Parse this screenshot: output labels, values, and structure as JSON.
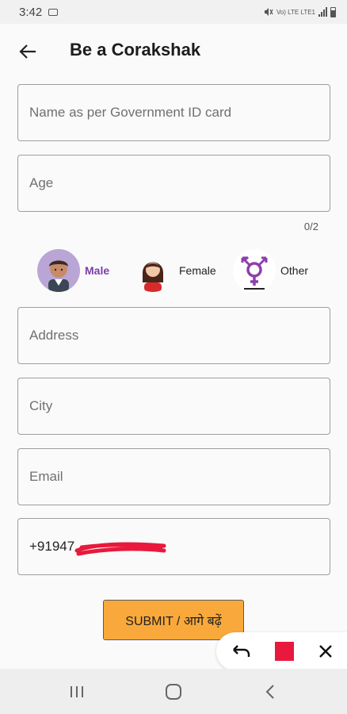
{
  "status_bar": {
    "time": "3:42",
    "network_label": "Vo) LTE LTE1"
  },
  "app_bar": {
    "title": "Be a Corakshak",
    "back_icon": "arrow-left-icon"
  },
  "form": {
    "name_placeholder": "Name as per Government ID card",
    "age_placeholder": "Age",
    "age_counter": "0/2",
    "gender_options": [
      {
        "label": "Male",
        "selected": true
      },
      {
        "label": "Female",
        "selected": false
      },
      {
        "label": "Other",
        "selected": false
      }
    ],
    "address_placeholder": "Address",
    "city_placeholder": "City",
    "email_placeholder": "Email",
    "phone_value": "+91947"
  },
  "submit_label": "SUBMIT / आगे बढ़ें",
  "overlay_tools": [
    "undo-icon",
    "color-swatch-icon",
    "close-icon"
  ],
  "colors": {
    "accent_purple": "#7b3fa8",
    "submit_orange": "#f9a93b",
    "redaction_red": "#e8193c"
  },
  "nav_bar": [
    "recents-icon",
    "home-icon",
    "back-icon"
  ]
}
